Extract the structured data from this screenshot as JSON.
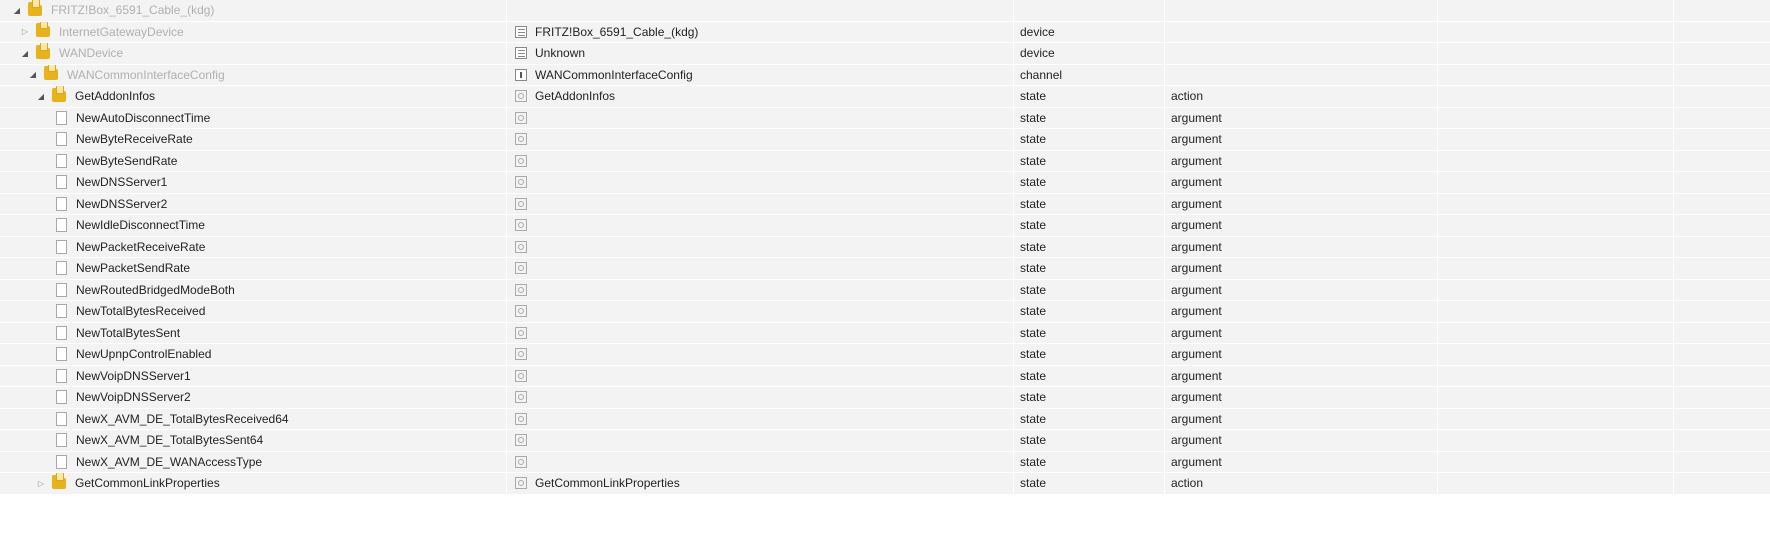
{
  "tree": {
    "rows": [
      {
        "name": "FRITZ!Box_6591_Cable_(kdg)",
        "level": 0,
        "expander": "open",
        "node_icon": "folder-icon",
        "object_icon": "",
        "object_name": "",
        "type": "",
        "role": "",
        "dim": true
      },
      {
        "name": "InternetGatewayDevice",
        "level": 1,
        "expander": "closed",
        "node_icon": "folder-icon",
        "object_icon": "device-icon",
        "object_name": "FRITZ!Box_6591_Cable_(kdg)",
        "type": "device",
        "role": "",
        "dim": true
      },
      {
        "name": "WANDevice",
        "level": 1,
        "expander": "open",
        "node_icon": "folder-icon",
        "object_icon": "device-icon",
        "object_name": "Unknown",
        "type": "device",
        "role": "",
        "dim": true
      },
      {
        "name": "WANCommonInterfaceConfig",
        "level": 2,
        "expander": "open",
        "node_icon": "folder-icon",
        "object_icon": "channel-icon",
        "object_name": "WANCommonInterfaceConfig",
        "type": "channel",
        "role": "",
        "dim": true
      },
      {
        "name": "GetAddonInfos",
        "level": 3,
        "expander": "open",
        "node_icon": "folder-icon",
        "object_icon": "state-icon",
        "object_name": "GetAddonInfos",
        "type": "state",
        "role": "action",
        "dim": false
      },
      {
        "name": "NewAutoDisconnectTime",
        "level": 4,
        "expander": "",
        "node_icon": "file-icon",
        "object_icon": "state-icon",
        "object_name": "",
        "type": "state",
        "role": "argument",
        "dim": false
      },
      {
        "name": "NewByteReceiveRate",
        "level": 4,
        "expander": "",
        "node_icon": "file-icon",
        "object_icon": "state-icon",
        "object_name": "",
        "type": "state",
        "role": "argument",
        "dim": false
      },
      {
        "name": "NewByteSendRate",
        "level": 4,
        "expander": "",
        "node_icon": "file-icon",
        "object_icon": "state-icon",
        "object_name": "",
        "type": "state",
        "role": "argument",
        "dim": false
      },
      {
        "name": "NewDNSServer1",
        "level": 4,
        "expander": "",
        "node_icon": "file-icon",
        "object_icon": "state-icon",
        "object_name": "",
        "type": "state",
        "role": "argument",
        "dim": false
      },
      {
        "name": "NewDNSServer2",
        "level": 4,
        "expander": "",
        "node_icon": "file-icon",
        "object_icon": "state-icon",
        "object_name": "",
        "type": "state",
        "role": "argument",
        "dim": false
      },
      {
        "name": "NewIdleDisconnectTime",
        "level": 4,
        "expander": "",
        "node_icon": "file-icon",
        "object_icon": "state-icon",
        "object_name": "",
        "type": "state",
        "role": "argument",
        "dim": false
      },
      {
        "name": "NewPacketReceiveRate",
        "level": 4,
        "expander": "",
        "node_icon": "file-icon",
        "object_icon": "state-icon",
        "object_name": "",
        "type": "state",
        "role": "argument",
        "dim": false
      },
      {
        "name": "NewPacketSendRate",
        "level": 4,
        "expander": "",
        "node_icon": "file-icon",
        "object_icon": "state-icon",
        "object_name": "",
        "type": "state",
        "role": "argument",
        "dim": false
      },
      {
        "name": "NewRoutedBridgedModeBoth",
        "level": 4,
        "expander": "",
        "node_icon": "file-icon",
        "object_icon": "state-icon",
        "object_name": "",
        "type": "state",
        "role": "argument",
        "dim": false
      },
      {
        "name": "NewTotalBytesReceived",
        "level": 4,
        "expander": "",
        "node_icon": "file-icon",
        "object_icon": "state-icon",
        "object_name": "",
        "type": "state",
        "role": "argument",
        "dim": false
      },
      {
        "name": "NewTotalBytesSent",
        "level": 4,
        "expander": "",
        "node_icon": "file-icon",
        "object_icon": "state-icon",
        "object_name": "",
        "type": "state",
        "role": "argument",
        "dim": false
      },
      {
        "name": "NewUpnpControlEnabled",
        "level": 4,
        "expander": "",
        "node_icon": "file-icon",
        "object_icon": "state-icon",
        "object_name": "",
        "type": "state",
        "role": "argument",
        "dim": false
      },
      {
        "name": "NewVoipDNSServer1",
        "level": 4,
        "expander": "",
        "node_icon": "file-icon",
        "object_icon": "state-icon",
        "object_name": "",
        "type": "state",
        "role": "argument",
        "dim": false
      },
      {
        "name": "NewVoipDNSServer2",
        "level": 4,
        "expander": "",
        "node_icon": "file-icon",
        "object_icon": "state-icon",
        "object_name": "",
        "type": "state",
        "role": "argument",
        "dim": false
      },
      {
        "name": "NewX_AVM_DE_TotalBytesReceived64",
        "level": 4,
        "expander": "",
        "node_icon": "file-icon",
        "object_icon": "state-icon",
        "object_name": "",
        "type": "state",
        "role": "argument",
        "dim": false
      },
      {
        "name": "NewX_AVM_DE_TotalBytesSent64",
        "level": 4,
        "expander": "",
        "node_icon": "file-icon",
        "object_icon": "state-icon",
        "object_name": "",
        "type": "state",
        "role": "argument",
        "dim": false
      },
      {
        "name": "NewX_AVM_DE_WANAccessType",
        "level": 4,
        "expander": "",
        "node_icon": "file-icon",
        "object_icon": "state-icon",
        "object_name": "",
        "type": "state",
        "role": "argument",
        "dim": false
      },
      {
        "name": "GetCommonLinkProperties",
        "level": 3,
        "expander": "closed",
        "node_icon": "folder-icon",
        "object_icon": "state-icon",
        "object_name": "GetCommonLinkProperties",
        "type": "state",
        "role": "action",
        "dim": false
      }
    ]
  }
}
